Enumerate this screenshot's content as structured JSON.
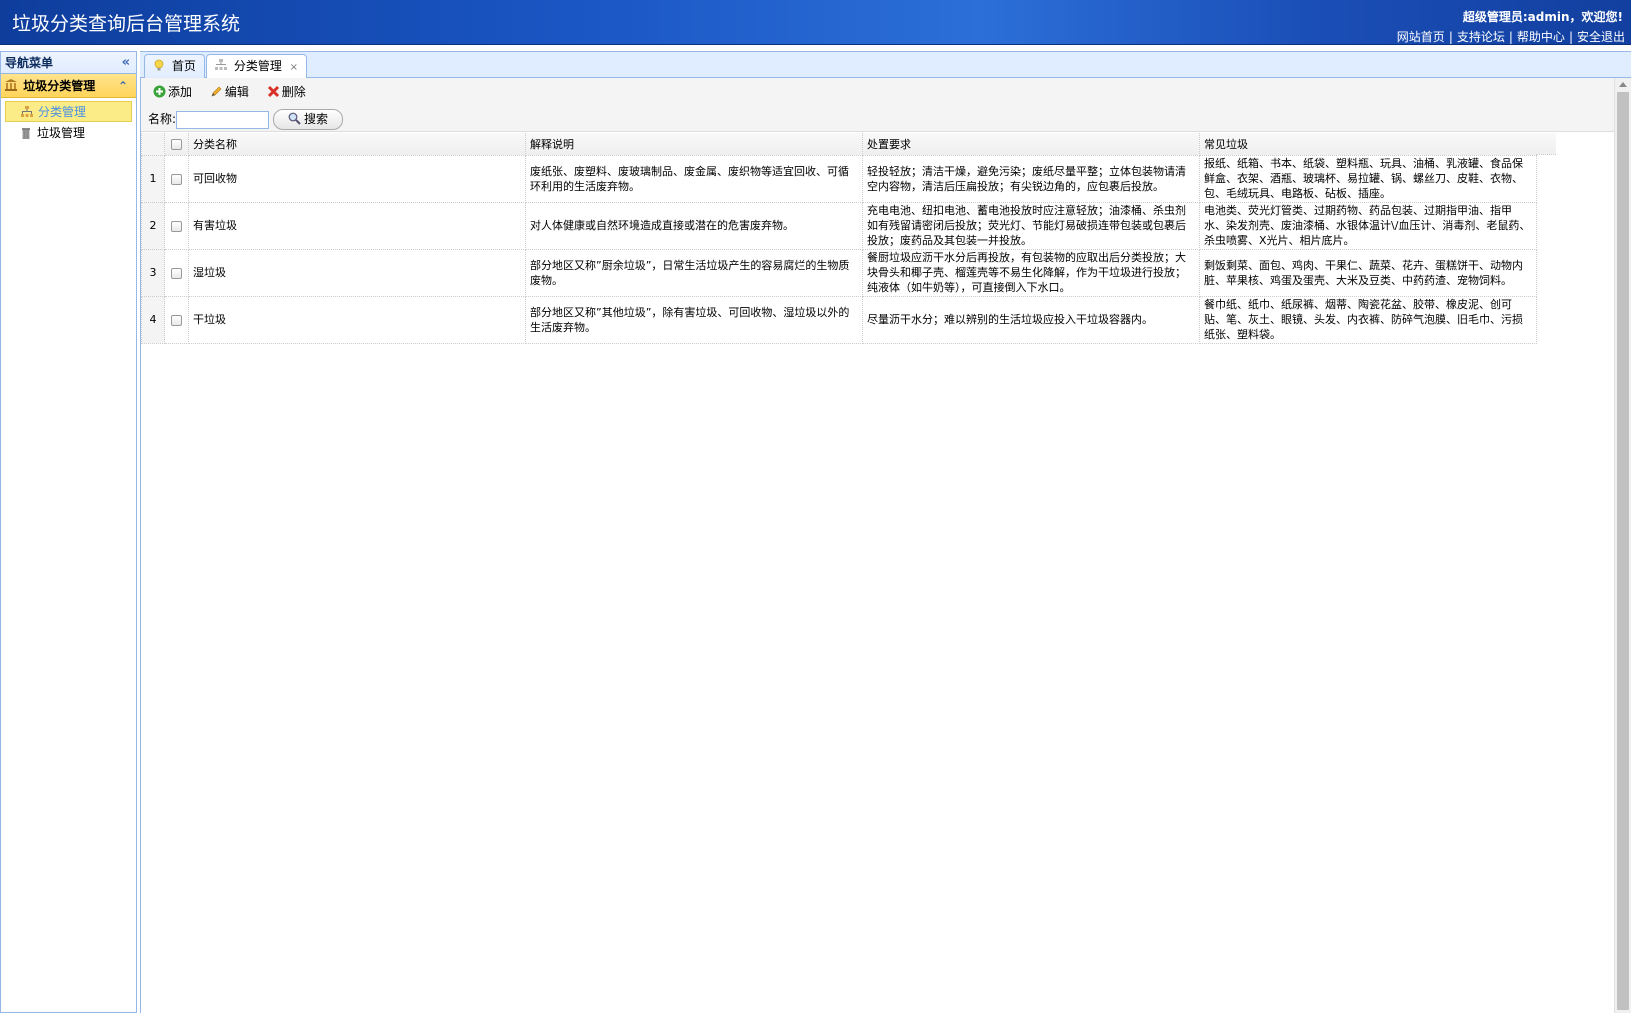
{
  "header": {
    "title": "垃圾分类查询后台管理系统",
    "welcome": "超级管理员:admin，欢迎您!",
    "links": [
      "网站首页",
      "支持论坛",
      "帮助中心",
      "安全退出"
    ]
  },
  "sidebar": {
    "heading": "导航菜单",
    "collapse_glyph": "«",
    "group": {
      "label": "垃圾分类管理",
      "expand_glyph": "⌃",
      "icon": "bank-icon"
    },
    "items": [
      {
        "label": "分类管理",
        "icon": "sitemap-icon",
        "selected": true
      },
      {
        "label": "垃圾管理",
        "icon": "trash-can-icon",
        "selected": false
      }
    ]
  },
  "tabs": [
    {
      "label": "首页",
      "icon": "lightbulb-icon",
      "active": false,
      "closable": false
    },
    {
      "label": "分类管理",
      "icon": "sitemap-icon",
      "active": true,
      "closable": true,
      "close_glyph": "×"
    }
  ],
  "toolbar": {
    "add_label": "添加",
    "edit_label": "编辑",
    "delete_label": "删除"
  },
  "search": {
    "label": "名称:",
    "value": "",
    "button_label": "搜索"
  },
  "grid": {
    "columns": [
      "分类名称",
      "解释说明",
      "处置要求",
      "常见垃圾"
    ],
    "rows": [
      {
        "num": "1",
        "name": "可回收物",
        "desc": "废纸张、废塑料、废玻璃制品、废金属、废织物等适宜回收、可循环利用的生活废弃物。",
        "req": "轻投轻放；清洁干燥，避免污染；废纸尽量平整；立体包装物请清空内容物，清洁后压扁投放；有尖锐边角的，应包裹后投放。",
        "common": "报纸、纸箱、书本、纸袋、塑料瓶、玩具、油桶、乳液罐、食品保鲜盒、衣架、酒瓶、玻璃杯、易拉罐、锅、螺丝刀、皮鞋、衣物、包、毛绒玩具、电路板、砧板、插座。"
      },
      {
        "num": "2",
        "name": "有害垃圾",
        "desc": "对人体健康或自然环境造成直接或潜在的危害废弃物。",
        "req": "充电电池、纽扣电池、蓄电池投放时应注意轻放；油漆桶、杀虫剂如有残留请密闭后投放；荧光灯、节能灯易破损连带包装或包裹后投放；废药品及其包装一并投放。",
        "common": "电池类、荧光灯管类、过期药物、药品包装、过期指甲油、指甲水、染发剂壳、废油漆桶、水银体温计\\/血压计、消毒剂、老鼠药、杀虫喷雾、X光片、相片底片。"
      },
      {
        "num": "3",
        "name": "湿垃圾",
        "desc": "部分地区又称”厨余垃圾”，日常生活垃圾产生的容易腐烂的生物质废物。",
        "req": "餐厨垃圾应沥干水分后再投放，有包装物的应取出后分类投放；大块骨头和椰子壳、榴莲壳等不易生化降解，作为干垃圾进行投放；纯液体（如牛奶等），可直接倒入下水口。",
        "common": "剩饭剩菜、面包、鸡肉、干果仁、蔬菜、花卉、蛋糕饼干、动物内脏、苹果核、鸡蛋及蛋壳、大米及豆类、中药药渣、宠物饲料。"
      },
      {
        "num": "4",
        "name": "干垃圾",
        "desc": "部分地区又称”其他垃圾”，除有害垃圾、可回收物、湿垃圾以外的生活废弃物。",
        "req": "尽量沥干水分；难以辨别的生活垃圾应投入干垃圾容器内。",
        "common": "餐巾纸、纸巾、纸尿裤、烟蒂、陶瓷花盆、胶带、橡皮泥、创可贴、笔、灰土、眼镜、头发、内衣裤、防碎气泡膜、旧毛巾、污损纸张、塑料袋。"
      }
    ]
  },
  "colors": {
    "header_blue": "#1a56c4",
    "panel_border": "#95b8e7",
    "selected_bg": "#fbec88",
    "group_bg": "#ffd45a"
  }
}
